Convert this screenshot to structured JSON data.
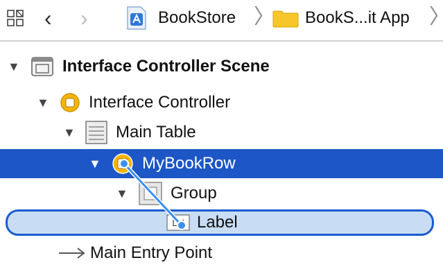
{
  "toolbar": {
    "grid_icon": "related-items-grid-icon",
    "back_icon": "chevron-left-icon",
    "forward_icon": "chevron-right-icon",
    "breadcrumb": [
      {
        "label": "BookStore",
        "icon": "xcode-project-icon"
      },
      {
        "label": "BookS...it App",
        "icon": "folder-icon"
      }
    ]
  },
  "tree": {
    "scene": {
      "label": "Interface Controller Scene",
      "icon": "scene-icon"
    },
    "controller": {
      "label": "Interface Controller",
      "icon": "interface-controller-icon"
    },
    "table": {
      "label": "Main Table",
      "icon": "table-icon"
    },
    "row": {
      "label": "MyBookRow",
      "icon": "row-controller-icon",
      "selected": true
    },
    "group": {
      "label": "Group",
      "icon": "group-icon"
    },
    "label_item": {
      "label": "Label",
      "icon": "label-icon"
    },
    "entry": {
      "label": "Main Entry Point",
      "icon": "arrow-right-icon"
    }
  },
  "colors": {
    "selection": "#1d56c6",
    "drag_target_fill": "#c8dcf4",
    "drag_target_border": "#1a5bd0",
    "controller_yellow": "#f5b400",
    "folder_yellow": "#f7c62a"
  }
}
